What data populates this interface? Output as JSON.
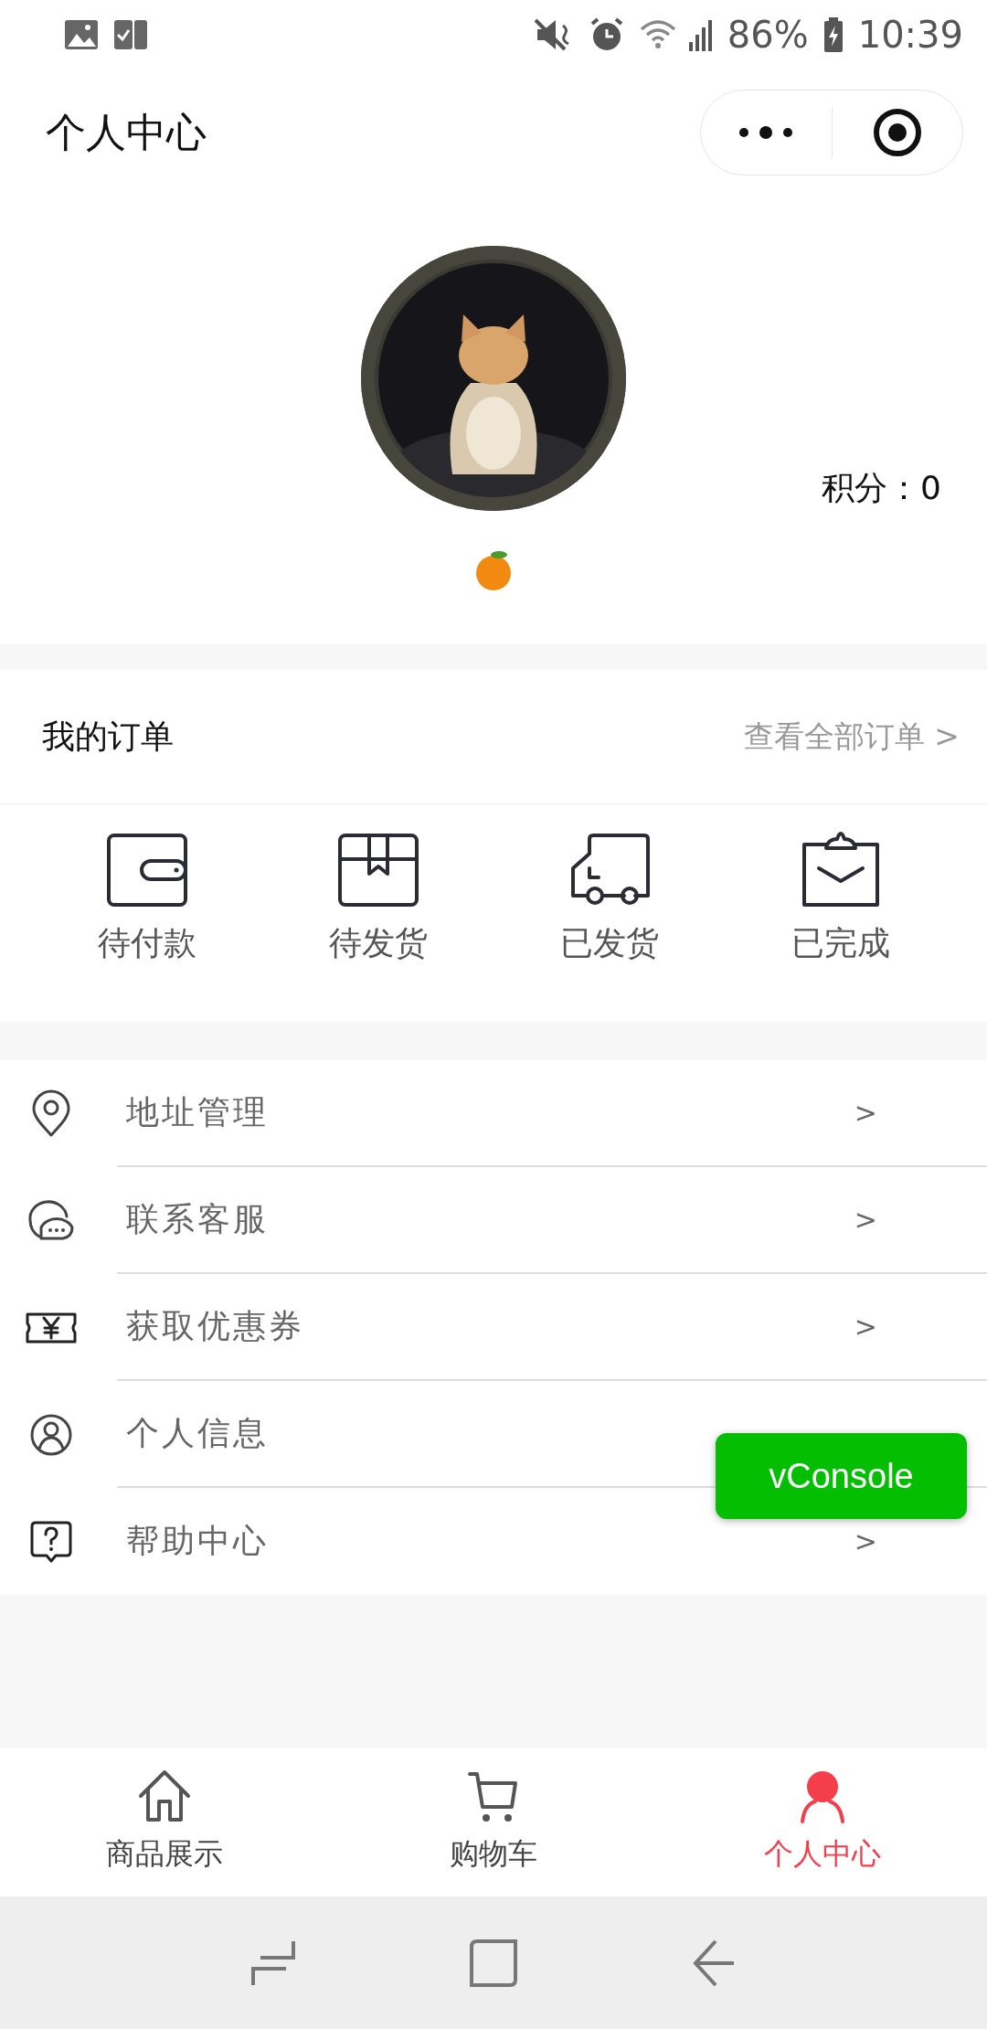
{
  "status_bar": {
    "battery": "86%",
    "time": "10:39"
  },
  "header": {
    "title": "个人中心"
  },
  "profile": {
    "points": "积分：0"
  },
  "orders": {
    "title": "我的订单",
    "view_all": "查看全部订单 >",
    "items": [
      {
        "kind": "wallet",
        "label": "待付款"
      },
      {
        "kind": "box",
        "label": "待发货"
      },
      {
        "kind": "truck",
        "label": "已发货"
      },
      {
        "kind": "clipboard",
        "label": "已完成"
      }
    ]
  },
  "menu": [
    {
      "kind": "location",
      "label": "地址管理",
      "arrow": ">"
    },
    {
      "kind": "chat",
      "label": "联系客服",
      "arrow": ">"
    },
    {
      "kind": "coupon",
      "label": "获取优惠券",
      "arrow": ">"
    },
    {
      "kind": "person",
      "label": "个人信息"
    },
    {
      "kind": "help",
      "label": "帮助中心",
      "arrow": ">"
    }
  ],
  "console_button": "vConsole",
  "tab_bar": [
    {
      "kind": "home",
      "label": "商品展示",
      "selected": false
    },
    {
      "kind": "cart",
      "label": "购物车",
      "selected": false
    },
    {
      "kind": "user",
      "label": "个人中心",
      "selected": true
    }
  ]
}
